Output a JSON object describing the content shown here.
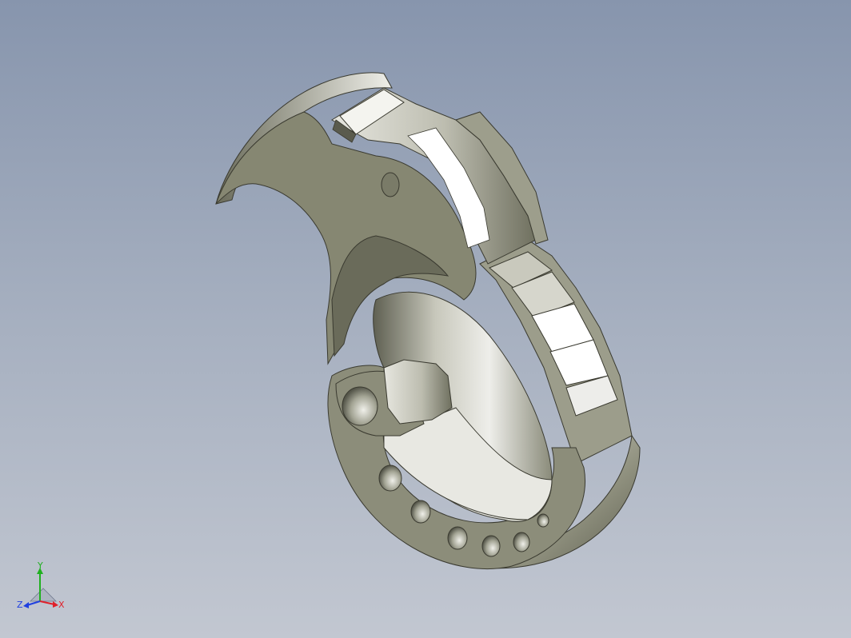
{
  "viewport": {
    "background_top": "#8795ad",
    "background_bottom": "#c2c7d1"
  },
  "model": {
    "part_color": "#8a8b78",
    "highlight_color": "#f2f2ee",
    "shadow_color": "#6e6f5e"
  },
  "triad": {
    "x_label": "X",
    "y_label": "Y",
    "z_label": "Z",
    "x_color": "#e0202a",
    "y_color": "#20b020",
    "z_color": "#2040e0"
  }
}
